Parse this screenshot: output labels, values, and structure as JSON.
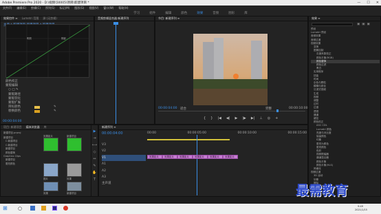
{
  "window": {
    "title": "Adobe Premiere Pro 2020 - D:\\视频\\50005\\项目\\新建项目 *",
    "controls": [
      "—",
      "☐",
      "✕"
    ]
  },
  "menu": [
    "文件(F)",
    "编辑(E)",
    "剪辑(C)",
    "序列(S)",
    "标记(M)",
    "图形(G)",
    "视图(V)",
    "窗口(W)",
    "帮助(H)"
  ],
  "workspaces": [
    "学习",
    "组件",
    "编辑",
    "颜色",
    "效果",
    "音频",
    "图形",
    "库"
  ],
  "workspace_active": "效果",
  "effects_controls": {
    "tabs": [
      "效果控件 ≡",
      "Lumetri 范围",
      "源:(无剪辑)",
      "音频剪辑混合器:新建序列"
    ],
    "clip_header": "主要 * 新建项目  新建项目 * 新建项目",
    "graph_labels": [
      "明亮",
      "阴影"
    ],
    "curve_label": "颜色校正",
    "rows": [
      "蒙版编辑",
      "○ □ ✎",
      "蒙版路径",
      "蒙版羽化",
      "蒙版扩展",
      "目标颜色",
      "替换颜色",
      "匹配容差",
      "柔和度",
      "不透明度"
    ],
    "time": "00:00:04:00"
  },
  "track_panel": {
    "tabs": [
      "音频剪辑混合器:新建序列",
      "元数据"
    ]
  },
  "program": {
    "title": "节目: 新建序列 ≡",
    "timecode_left": "00:00:04:00",
    "fit": "适合",
    "quality": "完整",
    "timecode_right": "00:00:10:00"
  },
  "effects": {
    "title": "效果 ≡",
    "items": [
      "预设",
      "Lumetri 预设",
      "音频效果",
      "音频过渡",
      "视频效果",
      "变换",
      "图像控制",
      "灰度系数校正",
      "颜色平衡(RGB)",
      "颜色替换",
      "颜色过滤",
      "黑白",
      "实用程序",
      "扭曲",
      "时间",
      "杂色与颗粒",
      "模糊与锐化",
      "沉浸式视频",
      "生成",
      "视频",
      "调整",
      "过时",
      "过渡",
      "透视",
      "通道",
      "键控",
      "颜色校正",
      "ASC CDL",
      "Lumetri 颜色",
      "亮度与对比度",
      "保留颜色",
      "均衡",
      "更改为颜色",
      "更改颜色",
      "色彩",
      "视频限幅器",
      "通道混合器",
      "颜色平衡",
      "颜色平衡(HLS)",
      "风格化",
      "视频过渡",
      "3D 运动",
      "划像",
      "擦除",
      "沉浸式视频",
      "溶解"
    ]
  },
  "project": {
    "tabs": [
      "项目: 新建项目",
      "媒体浏览器",
      "库",
      "信息"
    ],
    "path": "新建项目.prproj",
    "list": [
      "新建项目",
      "C:新建项目",
      "C:新建项目",
      "新建项目",
      "颜色替换",
      "Graphics Clips",
      "新建项目",
      "更改颜色"
    ],
    "thumbs": [
      "效果影片",
      "新建项目",
      "图片",
      "效果",
      "效果",
      "新建项目"
    ]
  },
  "timeline": {
    "title": "新建序列 ≡",
    "timecode": "00:00:04:00",
    "ruler": [
      "00:00",
      "00:00:05:00",
      "00:00:10:00",
      "00:00:15:00"
    ],
    "tracks": [
      "V3",
      "V2",
      "V1",
      "A1",
      "A2",
      "A3",
      "主声道"
    ],
    "clips": [
      "效果影片",
      "效果影片",
      "效果影片",
      "效果影片",
      "效果影片",
      "效果影片"
    ]
  },
  "watermark": "最需教育",
  "taskbar": {
    "time": "9:49",
    "date": "2021/1/15"
  }
}
